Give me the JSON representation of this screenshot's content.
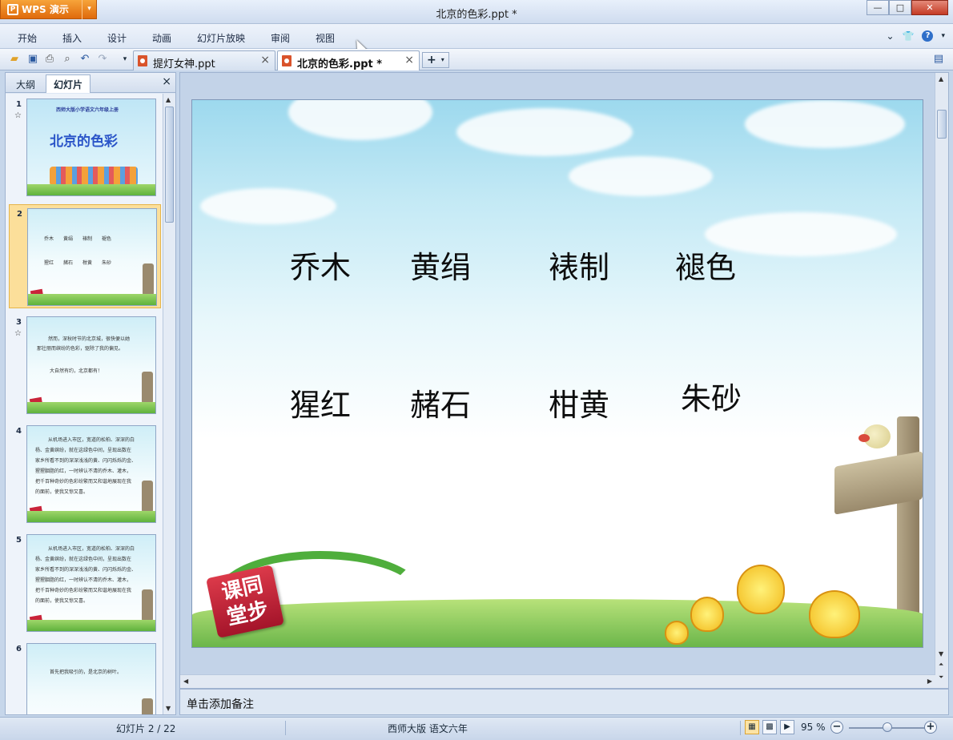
{
  "app": {
    "brand_label": "WPS 演示",
    "window_title": "北京的色彩.ppt *",
    "window_controls": {
      "minimize": "—",
      "maximize": "□",
      "close": "✕"
    }
  },
  "menu": {
    "items": [
      "开始",
      "插入",
      "设计",
      "动画",
      "幻灯片放映",
      "审阅",
      "视图"
    ],
    "right_icons": [
      "chevron-down-icon",
      "shirt-skin-icon",
      "help-icon"
    ],
    "help_label": "?"
  },
  "toolbar": {
    "quick_icons": [
      "open-folder-icon",
      "save-icon",
      "print-icon",
      "print-preview-icon",
      "undo-icon",
      "redo-icon",
      "customize-dropdown-icon"
    ],
    "tabs": [
      {
        "label": "提灯女神.ppt",
        "active": false
      },
      {
        "label": "北京的色彩.ppt *",
        "active": true
      }
    ],
    "new_tab_label": "+",
    "close_label": "×"
  },
  "left_pane": {
    "tabs": [
      {
        "label": "大纲",
        "active": false
      },
      {
        "label": "幻灯片",
        "active": true
      }
    ],
    "close_label": "×",
    "thumbnails": [
      {
        "number": "1",
        "has_animation": true,
        "selected": false,
        "lines": [
          "西师大版小学语文六年级上册",
          "北京的色彩"
        ]
      },
      {
        "number": "2",
        "has_animation": false,
        "selected": true,
        "lines": [
          "乔木　　黄绢　　裱制　　褪色",
          "猩红　　赭石　　柑黄　　朱砂"
        ]
      },
      {
        "number": "3",
        "has_animation": true,
        "selected": false,
        "lines": [
          "然而，深秋时节的北京城，很快便以她",
          "那壮丽而缤纷的色彩，驱除了我的偏见。",
          "大自然有约，北京都有！"
        ]
      },
      {
        "number": "4",
        "has_animation": false,
        "selected": false,
        "lines": [
          "从机场进入市区，宽道的松柏、深深的白",
          "杨、金黄缤纷，就在这绿色中间，呈现出数在",
          "家乡所看不到的深深浅浅的黄、闪闪烁烁的金、",
          "猩猩胭脂的红，一时辨认不清的乔木、灌木，",
          "把千百种奇妙的色彩纷繁而又和谐地展现在我",
          "的面前，使我又惊又喜。"
        ]
      },
      {
        "number": "5",
        "has_animation": false,
        "selected": false,
        "lines": [
          "从机场进入市区，宽道的松柏、深深的白",
          "杨、金黄缤纷，就在这绿色中间，呈现出数在",
          "家乡所看不到的深深浅浅的黄、闪闪烁烁的金、",
          "猩猩胭脂的红，一时辨认不清的乔木、灌木，",
          "把千百种奇妙的色彩纷繁而又和谐地展现在我",
          "的面前，使我又惊又喜。"
        ]
      },
      {
        "number": "6",
        "has_animation": false,
        "selected": false,
        "lines": [
          "首先把我吸引的，是北京的树叶。"
        ]
      }
    ]
  },
  "slide": {
    "row1": [
      "乔木",
      "黄绢",
      "裱制",
      "褪色"
    ],
    "row2": [
      "猩红",
      "赭石",
      "柑黄",
      "朱砂"
    ],
    "logo_text": "课同\n堂步"
  },
  "notes": {
    "placeholder": "单击添加备注"
  },
  "status": {
    "slide_count": "幻灯片 2 / 22",
    "template": "西师大版 语文六年",
    "zoom": "95 %",
    "zoom_fraction": 0.5,
    "view_icons": [
      "normal-view-icon",
      "slide-sorter-icon",
      "slideshow-icon"
    ]
  },
  "colors": {
    "brand_orange": "#e8791a",
    "selected_thumb": "#fcdf9a",
    "accent_red": "#c9243a"
  }
}
